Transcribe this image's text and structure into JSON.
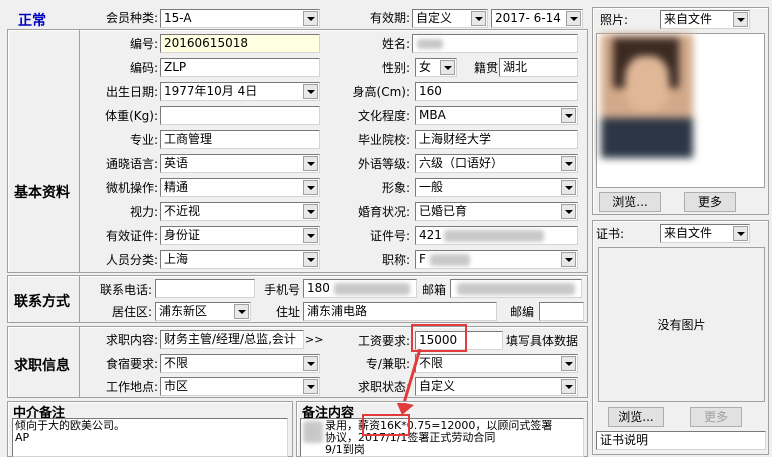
{
  "header": {
    "status": "正常",
    "member_type_label": "会员种类:",
    "member_type": "15-A",
    "validity_label": "有效期:",
    "validity_mode": "自定义",
    "validity_date": "2017- 6-14"
  },
  "basic": {
    "section_title": "基本资料",
    "id_label": "编号:",
    "id_value": "20160615018",
    "name_label": "姓名:",
    "code_label": "编码:",
    "code_value": "ZLP",
    "gender_label": "性别:",
    "gender_value": "女",
    "hometown_label": "籍贯",
    "hometown_value": "湖北",
    "birth_label": "出生日期:",
    "birth_value": "1977年10月 4日",
    "height_label": "身高(Cm):",
    "height_value": "160",
    "weight_label": "体重(Kg):",
    "weight_value": "",
    "education_label": "文化程度:",
    "education_value": "MBA",
    "major_label": "专业:",
    "major_value": "工商管理",
    "school_label": "毕业院校:",
    "school_value": "上海财经大学",
    "language_label": "通晓语言:",
    "language_value": "英语",
    "lang_level_label": "外语等级:",
    "lang_level_value": "六级（口语好）",
    "computer_label": "微机操作:",
    "computer_value": "精通",
    "appearance_label": "形象:",
    "appearance_value": "一般",
    "vision_label": "视力:",
    "vision_value": "不近视",
    "marriage_label": "婚育状况:",
    "marriage_value": "已婚已育",
    "cert_type_label": "有效证件:",
    "cert_type_value": "身份证",
    "cert_no_label": "证件号:",
    "cert_no_value": "421",
    "category_label": "人员分类:",
    "category_value": "上海",
    "title_label": "职称:",
    "title_value": "F"
  },
  "contact": {
    "section_title": "联系方式",
    "phone_label": "联系电话:",
    "phone_value": "",
    "mobile_label": "手机号",
    "mobile_value": "180",
    "email_label": "邮箱",
    "district_label": "居住区:",
    "district_value": "浦东新区",
    "address_label": "住址",
    "address_value": "浦东浦电路",
    "zip_label": "邮编",
    "zip_value": ""
  },
  "job": {
    "section_title": "求职信息",
    "content_label": "求职内容:",
    "content_value": "财务主管/经理/总监,会计",
    "content_more": ">>",
    "salary_label": "工资要求:",
    "salary_value": "15000",
    "salary_hint": "填写具体数据",
    "lodging_label": "食宿要求:",
    "lodging_value": "不限",
    "parttime_label": "专/兼职:",
    "parttime_value": "不限",
    "location_label": "工作地点:",
    "location_value": "市区",
    "status_label": "求职状态:",
    "status_value": "自定义"
  },
  "notes": {
    "agency_title": "中介备注",
    "agency_text": [
      "倾向于大的欧美公司。",
      "AP"
    ],
    "remark_title": "备注内容",
    "remark_text": [
      "录用，薪资16K*0.75=12000，以顾问式签署",
      "协议，2017/1/1签署正式劳动合同",
      "9/1到岗"
    ]
  },
  "photo": {
    "label": "照片:",
    "source": "来自文件",
    "browse": "浏览...",
    "more": "更多"
  },
  "certificate": {
    "label": "证书:",
    "source": "来自文件",
    "empty_text": "没有图片",
    "browse": "浏览...",
    "more": "更多",
    "desc": "证书说明"
  },
  "accent": {
    "status_text": "#0000c0",
    "highlight": "#e23b3b",
    "yellow_field": "#ffffe1"
  }
}
